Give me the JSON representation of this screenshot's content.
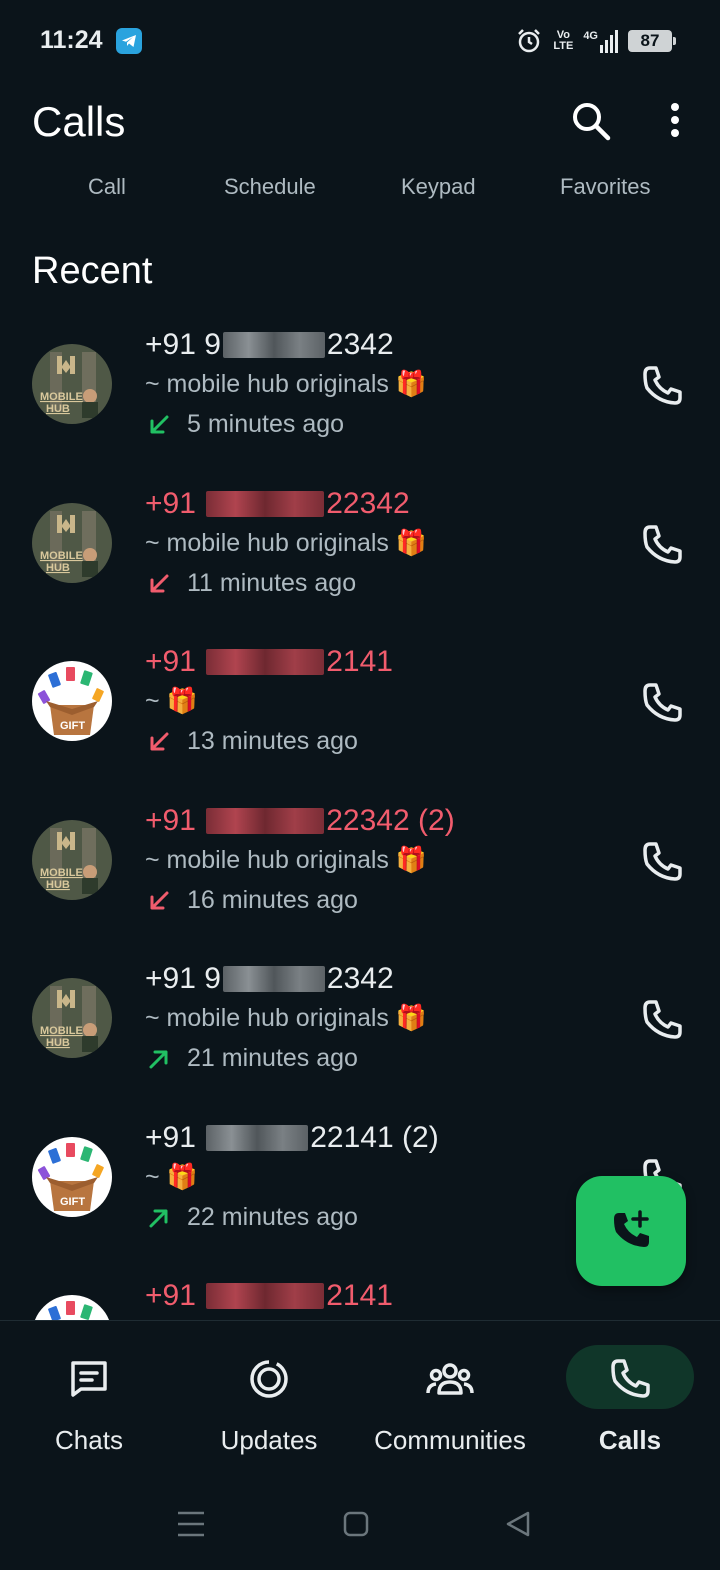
{
  "status_bar": {
    "time": "11:24",
    "volte_line1": "Vo",
    "volte_line2": "LTE",
    "network": "4G",
    "battery": "87"
  },
  "header": {
    "title": "Calls"
  },
  "tabs": [
    "Call",
    "Schedule",
    "Keypad",
    "Favorites"
  ],
  "section_title": "Recent",
  "calls": [
    {
      "prefix": "+91",
      "suffix": "2342",
      "lead": "9",
      "count": "",
      "missed": false,
      "subtitle": "~ mobile hub originals 🎁",
      "direction": "incoming",
      "time": "5 minutes ago",
      "avatar": "mobile-hub"
    },
    {
      "prefix": "+91",
      "suffix": "22342",
      "lead": "",
      "count": "",
      "missed": true,
      "subtitle": "~ mobile hub originals 🎁",
      "direction": "missed",
      "time": "11 minutes ago",
      "avatar": "mobile-hub"
    },
    {
      "prefix": "+91",
      "suffix": "2141",
      "lead": "",
      "count": "",
      "missed": true,
      "subtitle": "~ 🎁",
      "direction": "missed",
      "time": "13 minutes ago",
      "avatar": "gift"
    },
    {
      "prefix": "+91",
      "suffix": "22342",
      "lead": "",
      "count": "(2)",
      "missed": true,
      "subtitle": "~ mobile hub originals 🎁",
      "direction": "missed",
      "time": "16 minutes ago",
      "avatar": "mobile-hub"
    },
    {
      "prefix": "+91",
      "suffix": "2342",
      "lead": "9",
      "count": "",
      "missed": false,
      "subtitle": "~ mobile hub originals 🎁",
      "direction": "outgoing",
      "time": "21 minutes ago",
      "avatar": "mobile-hub"
    },
    {
      "prefix": "+91",
      "suffix": "22141",
      "lead": "",
      "count": "(2)",
      "missed": false,
      "subtitle": "~ 🎁",
      "direction": "outgoing",
      "time": "22 minutes ago",
      "avatar": "gift"
    },
    {
      "prefix": "+91",
      "suffix": "2141",
      "lead": "",
      "count": "",
      "missed": true,
      "subtitle": "",
      "direction": "missed",
      "time": "",
      "avatar": "gift"
    }
  ],
  "avatar_text": {
    "mobile_hub": "MOBILE HUB",
    "gift": "GIFT"
  },
  "bottom_nav": [
    {
      "label": "Chats",
      "icon": "chats-icon"
    },
    {
      "label": "Updates",
      "icon": "updates-icon"
    },
    {
      "label": "Communities",
      "icon": "communities-icon"
    },
    {
      "label": "Calls",
      "icon": "calls-icon",
      "active": true
    }
  ],
  "colors": {
    "background": "#0b141a",
    "missed": "#f15c6d",
    "accent": "#21c063",
    "active_pill": "#103629"
  }
}
